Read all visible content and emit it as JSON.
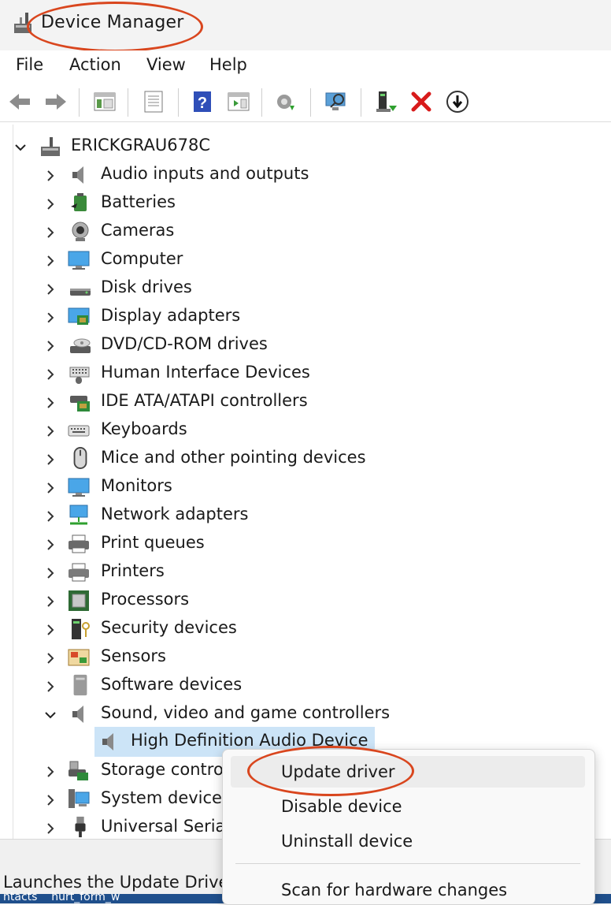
{
  "window": {
    "title": "Device Manager"
  },
  "menu": [
    "File",
    "Action",
    "View",
    "Help"
  ],
  "toolbar": {
    "buttons": [
      "back-arrow-icon",
      "forward-arrow-icon",
      "show-hide-tree-icon",
      "properties-icon",
      "help-icon",
      "action-pane-icon",
      "update-driver-icon",
      "scan-hardware-icon",
      "add-legacy-icon",
      "uninstall-icon",
      "disable-device-icon"
    ]
  },
  "tree": {
    "root": "ERICKGRAU678C",
    "categories": [
      "Audio inputs and outputs",
      "Batteries",
      "Cameras",
      "Computer",
      "Disk drives",
      "Display adapters",
      "DVD/CD-ROM drives",
      "Human Interface Devices",
      "IDE ATA/ATAPI controllers",
      "Keyboards",
      "Mice and other pointing devices",
      "Monitors",
      "Network adapters",
      "Print queues",
      "Printers",
      "Processors",
      "Security devices",
      "Sensors",
      "Software devices",
      "Sound, video and game controllers",
      "Storage contro",
      "System devices",
      "Universal Seria"
    ],
    "expanded_child": "High Definition Audio Device"
  },
  "context_menu": {
    "items": [
      "Update driver",
      "Disable device",
      "Uninstall device",
      "Scan for hardware changes"
    ]
  },
  "status": {
    "text": "Launches the Update Drive"
  },
  "taskbar_text": "ntacts    hurt_form_w"
}
